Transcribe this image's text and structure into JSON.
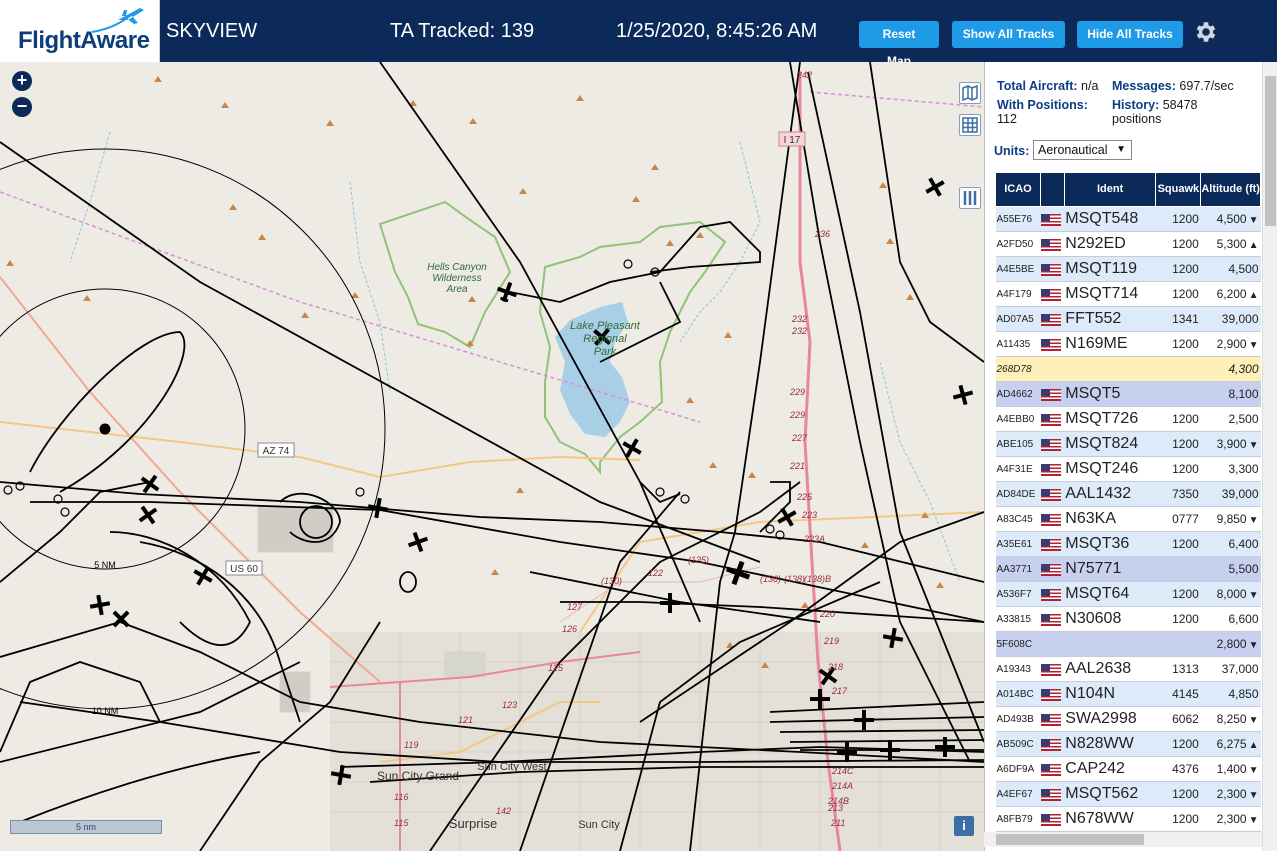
{
  "header": {
    "logo_text": "FlightAware",
    "app_name": "SKYVIEW",
    "ta_tracked": "TA Tracked: 139",
    "clock": "1/25/2020, 8:45:26 AM",
    "reset_map_label": "Reset Map",
    "show_all_tracks_label": "Show All Tracks",
    "hide_all_tracks_label": "Hide All Tracks",
    "settings_icon": "gear-icon"
  },
  "map": {
    "zoom_in_label": "+",
    "zoom_out_label": "−",
    "scale_label": "5 nm",
    "info_label": "i",
    "labels": {
      "hells_canyon": [
        "Hells Canyon",
        "Wilderness",
        "Area"
      ],
      "lake_pleasant": [
        "Lake Pleasant",
        "Regional",
        "Park"
      ],
      "az74": "AZ 74",
      "us60": "US 60",
      "i17": "I 17",
      "ring_5nm": "5 NM",
      "ring_10nm": "10 NM",
      "sun_city_grand": "Sun City Grand",
      "sun_city_west": "Sun City West",
      "surprise": "Surprise",
      "sun_city": "Sun City",
      "exit_numbers": [
        "242",
        "236",
        "232",
        "232",
        "229",
        "229",
        "227",
        "225",
        "223",
        "223A",
        "221",
        "220",
        "219",
        "218",
        "217",
        "214C",
        "214A",
        "214B",
        "213",
        "211",
        "125",
        "123",
        "121",
        "119",
        "116",
        "115",
        "142",
        "(135)",
        "(130)",
        "(136)",
        "(138)",
        "(138)B",
        "122",
        "127",
        "126"
      ]
    },
    "colors": {
      "map_bg": "#eeebe4",
      "water": "#a9cfe6",
      "park_border": "#8fc37a",
      "highway": "#e8879a",
      "road": "#f2c883",
      "track": "#000000"
    }
  },
  "panel": {
    "total_aircraft_label": "Total Aircraft:",
    "total_aircraft_value": "n/a",
    "with_positions_label": "With Positions:",
    "with_positions_value": "112",
    "messages_label": "Messages:",
    "messages_value": "697.7/sec",
    "history_label": "History:",
    "history_value": "58478 positions",
    "units_label": "Units:",
    "units_value": "Aeronautical",
    "columns": [
      "ICAO",
      "",
      "Ident",
      "Squawk",
      "Altitude (ft)"
    ],
    "rows": [
      {
        "icao": "A55E76",
        "flag": true,
        "ident": "MSQT548",
        "squawk": "1200",
        "alt": "4,500",
        "trend": "▼",
        "kind": "odd"
      },
      {
        "icao": "A2FD50",
        "flag": true,
        "ident": "N292ED",
        "squawk": "1200",
        "alt": "5,300",
        "trend": "▲",
        "kind": "even"
      },
      {
        "icao": "A4E5BE",
        "flag": true,
        "ident": "MSQT119",
        "squawk": "1200",
        "alt": "4,500",
        "trend": "",
        "kind": "odd"
      },
      {
        "icao": "A4F179",
        "flag": true,
        "ident": "MSQT714",
        "squawk": "1200",
        "alt": "6,200",
        "trend": "▲",
        "kind": "even"
      },
      {
        "icao": "AD07A5",
        "flag": true,
        "ident": "FFT552",
        "squawk": "1341",
        "alt": "39,000",
        "trend": "",
        "kind": "odd"
      },
      {
        "icao": "A11435",
        "flag": true,
        "ident": "N169ME",
        "squawk": "1200",
        "alt": "2,900",
        "trend": "▼",
        "kind": "even"
      },
      {
        "icao": "268D78",
        "flag": false,
        "ident": "",
        "squawk": "",
        "alt": "4,300",
        "trend": "",
        "kind": "mlat"
      },
      {
        "icao": "AD4662",
        "flag": true,
        "ident": "MSQT5",
        "squawk": "",
        "alt": "8,100",
        "trend": "",
        "kind": "sel"
      },
      {
        "icao": "A4EBB0",
        "flag": true,
        "ident": "MSQT726",
        "squawk": "1200",
        "alt": "2,500",
        "trend": "",
        "kind": "even"
      },
      {
        "icao": "ABE105",
        "flag": true,
        "ident": "MSQT824",
        "squawk": "1200",
        "alt": "3,900",
        "trend": "▼",
        "kind": "odd"
      },
      {
        "icao": "A4F31E",
        "flag": true,
        "ident": "MSQT246",
        "squawk": "1200",
        "alt": "3,300",
        "trend": "",
        "kind": "even"
      },
      {
        "icao": "AD84DE",
        "flag": true,
        "ident": "AAL1432",
        "squawk": "7350",
        "alt": "39,000",
        "trend": "",
        "kind": "odd"
      },
      {
        "icao": "A83C45",
        "flag": true,
        "ident": "N63KA",
        "squawk": "0777",
        "alt": "9,850",
        "trend": "▼",
        "kind": "even"
      },
      {
        "icao": "A35E61",
        "flag": true,
        "ident": "MSQT36",
        "squawk": "1200",
        "alt": "6,400",
        "trend": "",
        "kind": "odd"
      },
      {
        "icao": "AA3771",
        "flag": true,
        "ident": "N75771",
        "squawk": "",
        "alt": "5,500",
        "trend": "",
        "kind": "sel"
      },
      {
        "icao": "A536F7",
        "flag": true,
        "ident": "MSQT64",
        "squawk": "1200",
        "alt": "8,000",
        "trend": "▼",
        "kind": "odd"
      },
      {
        "icao": "A33815",
        "flag": true,
        "ident": "N30608",
        "squawk": "1200",
        "alt": "6,600",
        "trend": "",
        "kind": "even"
      },
      {
        "icao": "5F608C",
        "flag": false,
        "ident": "",
        "squawk": "",
        "alt": "2,800",
        "trend": "▼",
        "kind": "sel"
      },
      {
        "icao": "A19343",
        "flag": true,
        "ident": "AAL2638",
        "squawk": "1313",
        "alt": "37,000",
        "trend": "",
        "kind": "even"
      },
      {
        "icao": "A014BC",
        "flag": true,
        "ident": "N104N",
        "squawk": "4145",
        "alt": "4,850",
        "trend": "",
        "kind": "odd"
      },
      {
        "icao": "AD493B",
        "flag": true,
        "ident": "SWA2998",
        "squawk": "6062",
        "alt": "8,250",
        "trend": "▼",
        "kind": "even"
      },
      {
        "icao": "AB509C",
        "flag": true,
        "ident": "N828WW",
        "squawk": "1200",
        "alt": "6,275",
        "trend": "▲",
        "kind": "odd"
      },
      {
        "icao": "A6DF9A",
        "flag": true,
        "ident": "CAP242",
        "squawk": "4376",
        "alt": "1,400",
        "trend": "▼",
        "kind": "even"
      },
      {
        "icao": "A4EF67",
        "flag": true,
        "ident": "MSQT562",
        "squawk": "1200",
        "alt": "2,300",
        "trend": "▼",
        "kind": "odd"
      },
      {
        "icao": "A8FB79",
        "flag": true,
        "ident": "N678WW",
        "squawk": "1200",
        "alt": "2,300",
        "trend": "▼",
        "kind": "even"
      }
    ]
  }
}
